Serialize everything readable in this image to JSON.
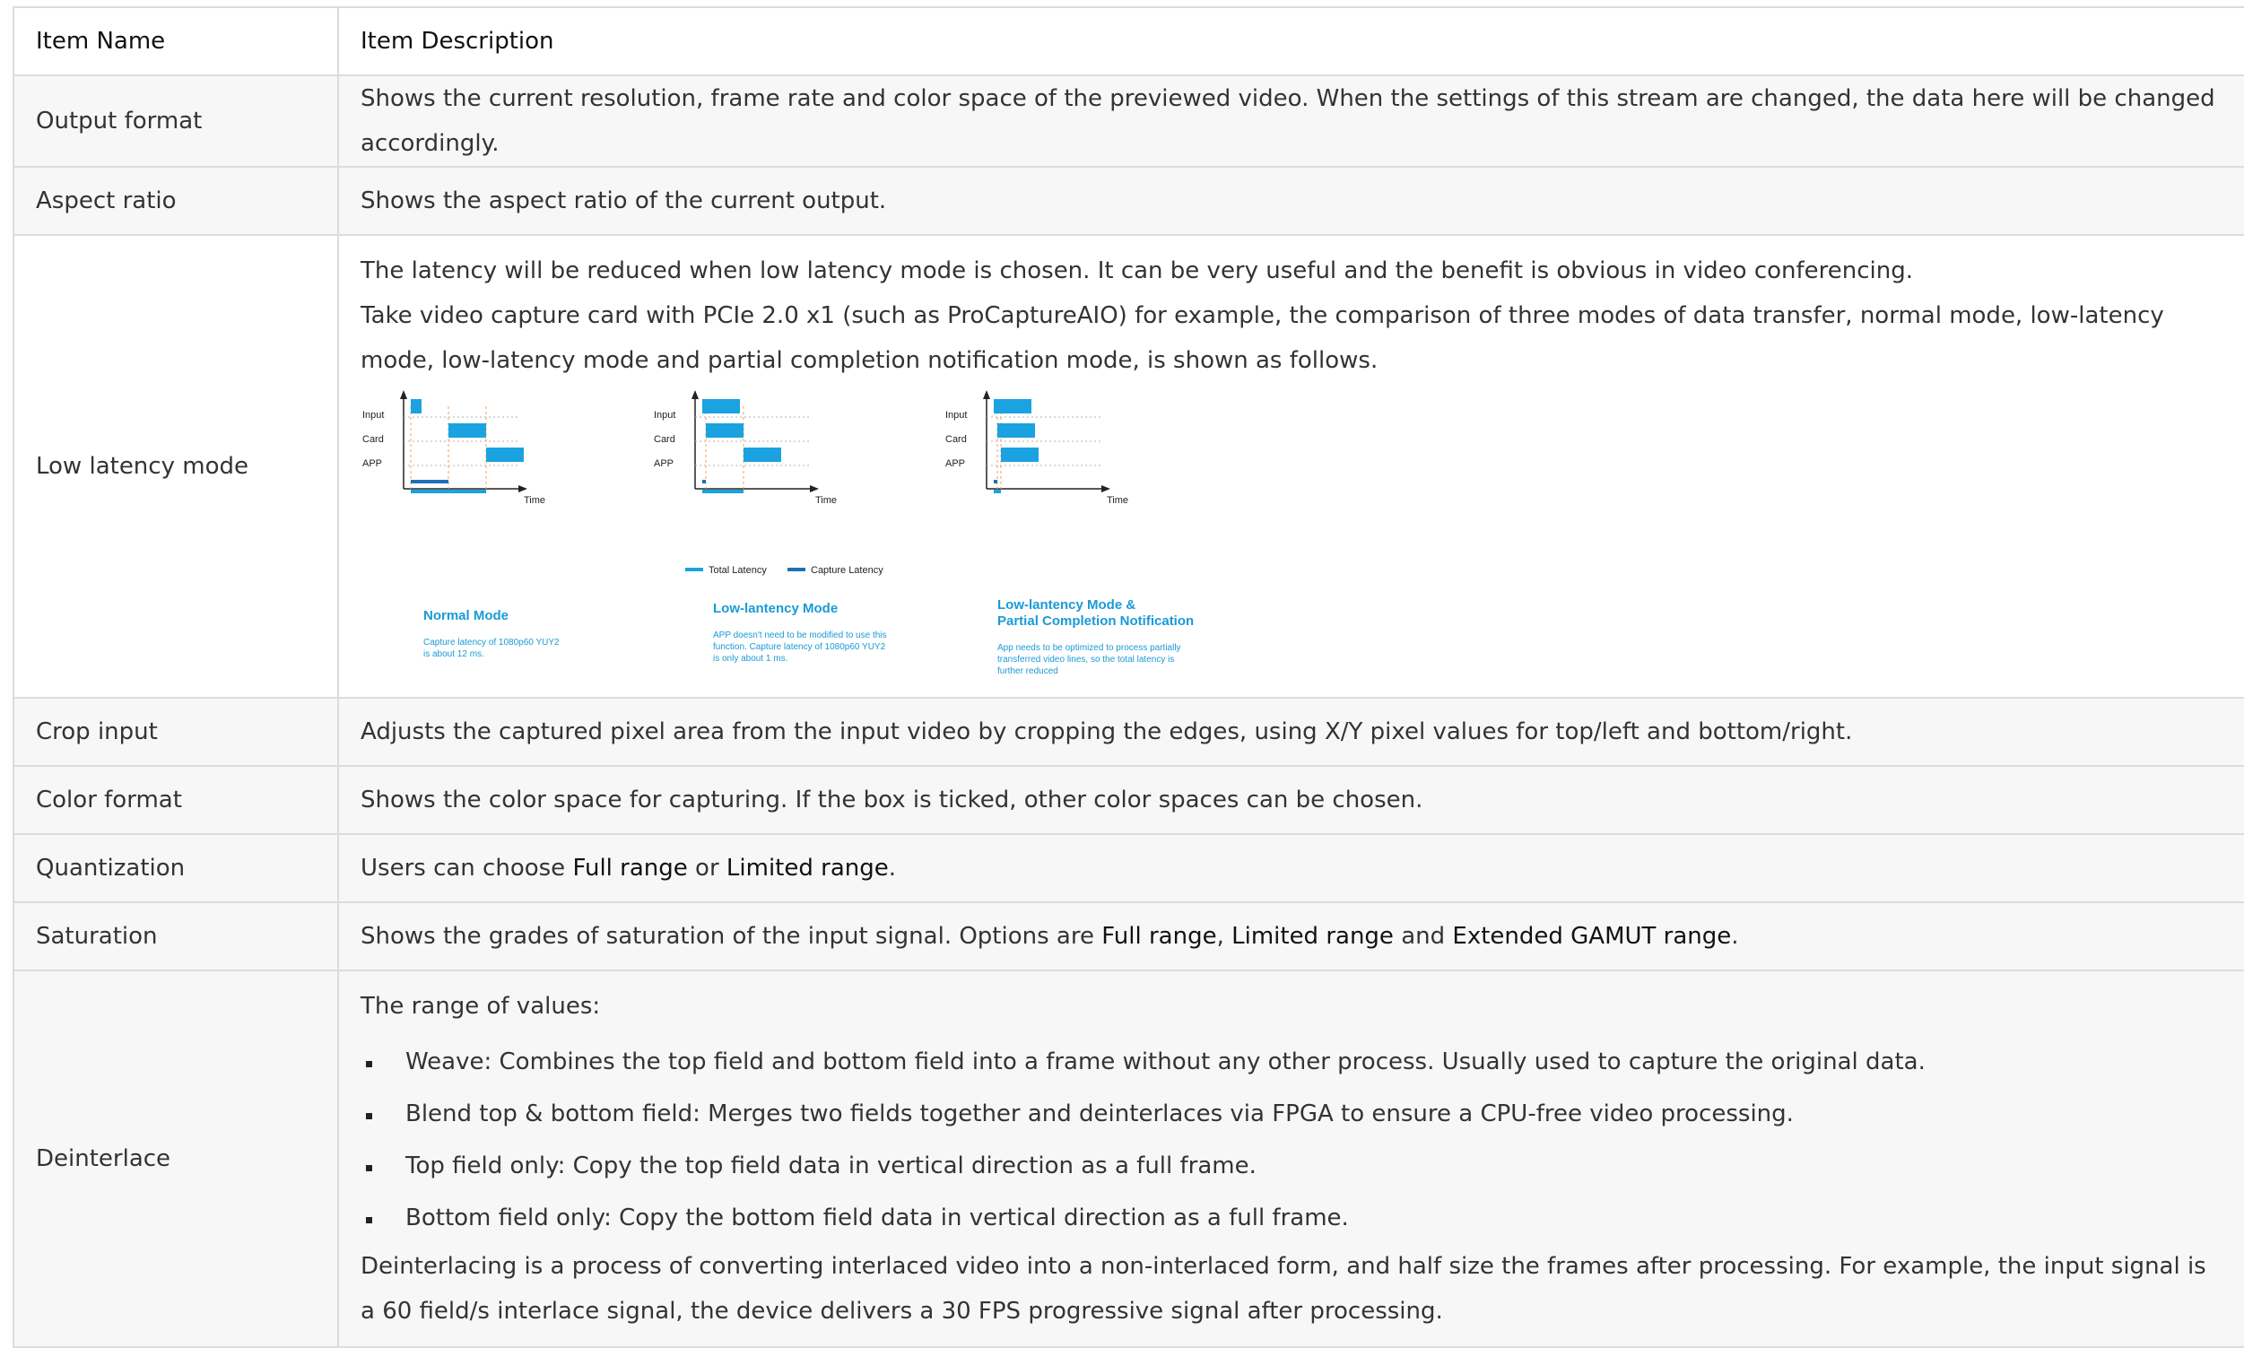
{
  "header": {
    "name": "Item Name",
    "description": "Item Description"
  },
  "rows": {
    "output_format": {
      "name": "Output format",
      "desc": "Shows the current resolution, frame rate and color space of the previewed video. When the settings of this stream are changed, the data here will be changed accordingly."
    },
    "aspect_ratio": {
      "name": "Aspect ratio",
      "desc": "Shows the aspect ratio of the current output."
    },
    "low_latency": {
      "name": "Low latency mode",
      "p1": "The latency will be reduced when low latency mode is chosen. It can be very useful and the benefit is obvious in video conferencing.",
      "p2": "Take video capture card with PCIe 2.0 x1 (such as ProCaptureAIO) for example, the comparison of three modes of data transfer, normal mode, low-latency mode, low-latency mode and partial completion notification mode, is shown as follows.",
      "figure": {
        "axis_labels": {
          "input": "Input",
          "card": "Card",
          "app": "APP",
          "time": "Time"
        },
        "legend": {
          "total": "Total Latency",
          "capture": "Capture Latency"
        },
        "colors": {
          "block": "#1aa3e0",
          "capture": "#1f6fb5",
          "dashed": "#f0a060",
          "title": "#1a9ad6"
        },
        "modes": [
          {
            "title": "Normal Mode",
            "note": [
              "Capture latency of 1080p60 YUY2",
              " is about 12 ms."
            ]
          },
          {
            "title": "Low-lantency Mode",
            "note": [
              "APP doesn't need to be modified to use this",
              "function. Capture latency of 1080p60 YUY2",
              "is only about 1 ms."
            ]
          },
          {
            "title": [
              "Low-lantency Mode &",
              "Partial Completion Notification"
            ],
            "note": [
              "App needs to be optimized to process partially",
              "transferred video lines, so the total latency is",
              "further reduced"
            ]
          }
        ]
      }
    },
    "crop_input": {
      "name": "Crop input",
      "desc": "Adjusts the captured pixel area from the input video by cropping the edges, using X/Y pixel values for top/left and bottom/right."
    },
    "color_format": {
      "name": "Color format",
      "desc": "Shows the color space for capturing. If the box is ticked, other color spaces can be chosen."
    },
    "quantization": {
      "name": "Quantization",
      "pre": "Users can choose ",
      "opt1": "Full range",
      "mid": " or ",
      "opt2": "Limited range",
      "post": "."
    },
    "saturation": {
      "name": "Saturation",
      "pre": "Shows the grades of saturation of the input signal. Options are  ",
      "opt1": "Full range",
      "sep1": ", ",
      "opt2": "Limited range",
      "sep2": " and ",
      "opt3": "Extended GAMUT range",
      "post": "."
    },
    "deinterlace": {
      "name": "Deinterlace",
      "intro": "The range of values:",
      "bullets": [
        "Weave: Combines the top field and bottom field into a frame without any other process. Usually used to capture the original data.",
        "Blend top & bottom field: Merges two fields together and deinterlaces via FPGA to ensure a CPU-free video processing.",
        "Top field only: Copy the top field data in vertical direction as a full frame.",
        "Bottom field only: Copy the bottom field data in vertical direction as a full frame."
      ],
      "tail": "Deinterlacing is a process of converting interlaced video into a non-interlaced form, and half size the frames after processing. For example, the input signal is a 60 field/s interlace signal, the device delivers a 30 FPS progressive signal after processing."
    }
  }
}
